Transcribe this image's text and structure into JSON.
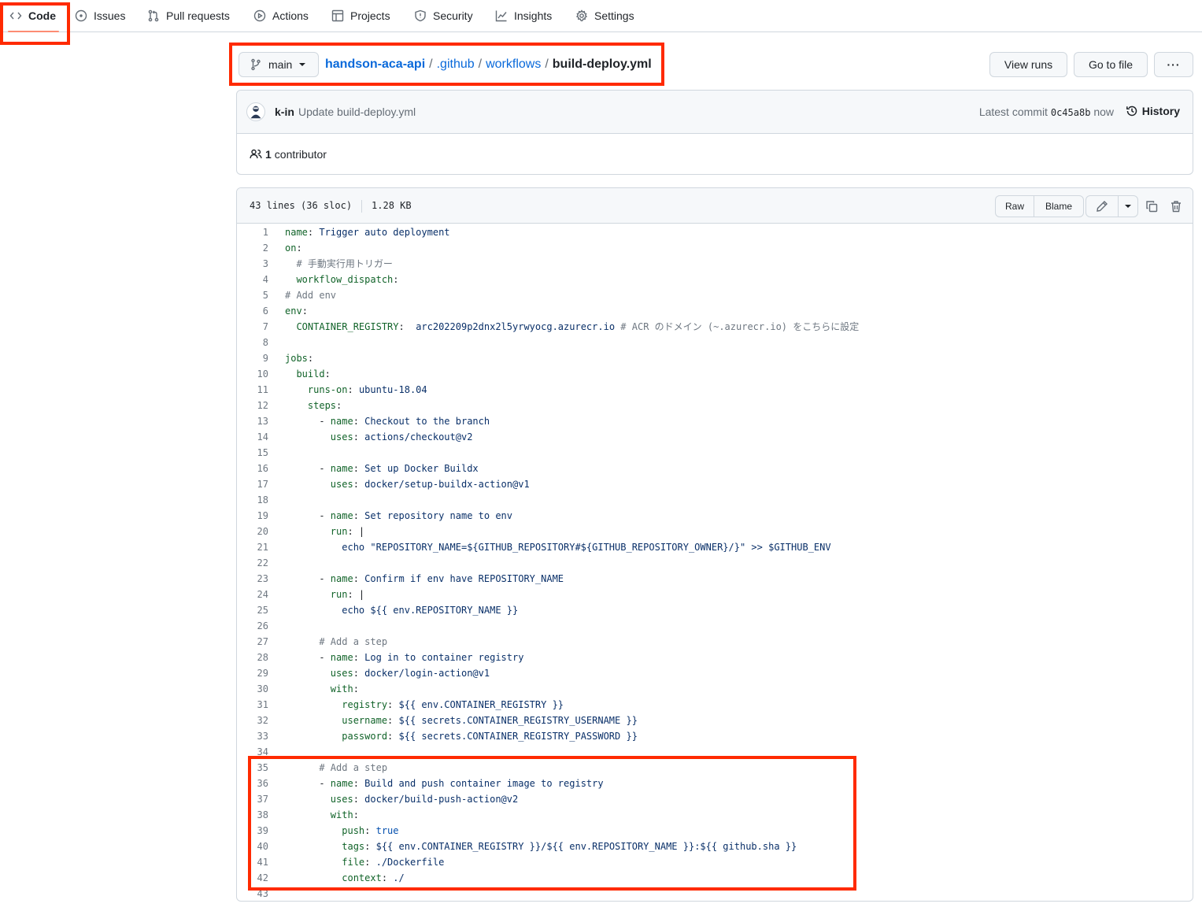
{
  "nav": {
    "tabs": [
      {
        "label": "Code",
        "icon": "code-icon"
      },
      {
        "label": "Issues",
        "icon": "issue-icon"
      },
      {
        "label": "Pull requests",
        "icon": "pull-request-icon"
      },
      {
        "label": "Actions",
        "icon": "play-icon"
      },
      {
        "label": "Projects",
        "icon": "table-icon"
      },
      {
        "label": "Security",
        "icon": "shield-icon"
      },
      {
        "label": "Insights",
        "icon": "graph-icon"
      },
      {
        "label": "Settings",
        "icon": "gear-icon"
      }
    ],
    "active": "Code"
  },
  "branch": {
    "name": "main"
  },
  "breadcrumb": {
    "repo": "handson-aca-api",
    "dir1": ".github",
    "dir2": "workflows",
    "file": "build-deploy.yml",
    "separator": "/"
  },
  "actions": {
    "view_runs": "View runs",
    "go_to_file": "Go to file",
    "more": "···"
  },
  "commit": {
    "author": "k-in",
    "message": "Update build-deploy.yml",
    "latest_label": "Latest commit",
    "sha": "0c45a8b",
    "time": "now",
    "history_label": "History"
  },
  "contributors": {
    "count": "1",
    "label": "contributor"
  },
  "file": {
    "lines_info": "43 lines (36 sloc)",
    "size": "1.28 KB",
    "raw_label": "Raw",
    "blame_label": "Blame"
  },
  "code_lines": [
    [
      [
        "k",
        "name"
      ],
      [
        "p",
        ": "
      ],
      [
        "v",
        "Trigger auto deployment"
      ]
    ],
    [
      [
        "k",
        "on"
      ],
      [
        "p",
        ":"
      ]
    ],
    [
      [
        "p",
        "  "
      ],
      [
        "c",
        "# 手動実行用トリガー"
      ]
    ],
    [
      [
        "p",
        "  "
      ],
      [
        "k",
        "workflow_dispatch"
      ],
      [
        "p",
        ":"
      ]
    ],
    [
      [
        "c",
        "# Add env"
      ]
    ],
    [
      [
        "k",
        "env"
      ],
      [
        "p",
        ":"
      ]
    ],
    [
      [
        "p",
        "  "
      ],
      [
        "k",
        "CONTAINER_REGISTRY"
      ],
      [
        "p",
        ":  "
      ],
      [
        "v",
        "arc202209p2dnx2l5yrwyocg.azurecr.io"
      ],
      [
        "p",
        " "
      ],
      [
        "c",
        "# ACR のドメイン (~.azurecr.io) をこちらに設定"
      ]
    ],
    [],
    [
      [
        "k",
        "jobs"
      ],
      [
        "p",
        ":"
      ]
    ],
    [
      [
        "p",
        "  "
      ],
      [
        "k",
        "build"
      ],
      [
        "p",
        ":"
      ]
    ],
    [
      [
        "p",
        "    "
      ],
      [
        "k",
        "runs-on"
      ],
      [
        "p",
        ": "
      ],
      [
        "v",
        "ubuntu-18.04"
      ]
    ],
    [
      [
        "p",
        "    "
      ],
      [
        "k",
        "steps"
      ],
      [
        "p",
        ":"
      ]
    ],
    [
      [
        "p",
        "      - "
      ],
      [
        "k",
        "name"
      ],
      [
        "p",
        ": "
      ],
      [
        "v",
        "Checkout to the branch"
      ]
    ],
    [
      [
        "p",
        "        "
      ],
      [
        "k",
        "uses"
      ],
      [
        "p",
        ": "
      ],
      [
        "v",
        "actions/checkout@v2"
      ]
    ],
    [],
    [
      [
        "p",
        "      - "
      ],
      [
        "k",
        "name"
      ],
      [
        "p",
        ": "
      ],
      [
        "v",
        "Set up Docker Buildx"
      ]
    ],
    [
      [
        "p",
        "        "
      ],
      [
        "k",
        "uses"
      ],
      [
        "p",
        ": "
      ],
      [
        "v",
        "docker/setup-buildx-action@v1"
      ]
    ],
    [],
    [
      [
        "p",
        "      - "
      ],
      [
        "k",
        "name"
      ],
      [
        "p",
        ": "
      ],
      [
        "v",
        "Set repository name to env"
      ]
    ],
    [
      [
        "p",
        "        "
      ],
      [
        "k",
        "run"
      ],
      [
        "p",
        ": |"
      ]
    ],
    [
      [
        "p",
        "          "
      ],
      [
        "v",
        "echo \"REPOSITORY_NAME=${GITHUB_REPOSITORY#${GITHUB_REPOSITORY_OWNER}/}\" >> $GITHUB_ENV"
      ]
    ],
    [],
    [
      [
        "p",
        "      - "
      ],
      [
        "k",
        "name"
      ],
      [
        "p",
        ": "
      ],
      [
        "v",
        "Confirm if env have REPOSITORY_NAME"
      ]
    ],
    [
      [
        "p",
        "        "
      ],
      [
        "k",
        "run"
      ],
      [
        "p",
        ": |"
      ]
    ],
    [
      [
        "p",
        "          "
      ],
      [
        "v",
        "echo ${{ env.REPOSITORY_NAME }}"
      ]
    ],
    [],
    [
      [
        "p",
        "      "
      ],
      [
        "c",
        "# Add a step"
      ]
    ],
    [
      [
        "p",
        "      - "
      ],
      [
        "k",
        "name"
      ],
      [
        "p",
        ": "
      ],
      [
        "v",
        "Log in to container registry"
      ]
    ],
    [
      [
        "p",
        "        "
      ],
      [
        "k",
        "uses"
      ],
      [
        "p",
        ": "
      ],
      [
        "v",
        "docker/login-action@v1"
      ]
    ],
    [
      [
        "p",
        "        "
      ],
      [
        "k",
        "with"
      ],
      [
        "p",
        ":"
      ]
    ],
    [
      [
        "p",
        "          "
      ],
      [
        "k",
        "registry"
      ],
      [
        "p",
        ": "
      ],
      [
        "v",
        "${{ env.CONTAINER_REGISTRY }}"
      ]
    ],
    [
      [
        "p",
        "          "
      ],
      [
        "k",
        "username"
      ],
      [
        "p",
        ": "
      ],
      [
        "v",
        "${{ secrets.CONTAINER_REGISTRY_USERNAME }}"
      ]
    ],
    [
      [
        "p",
        "          "
      ],
      [
        "k",
        "password"
      ],
      [
        "p",
        ": "
      ],
      [
        "v",
        "${{ secrets.CONTAINER_REGISTRY_PASSWORD }}"
      ]
    ],
    [],
    [
      [
        "p",
        "      "
      ],
      [
        "c",
        "# Add a step"
      ]
    ],
    [
      [
        "p",
        "      - "
      ],
      [
        "k",
        "name"
      ],
      [
        "p",
        ": "
      ],
      [
        "v",
        "Build and push container image to registry"
      ]
    ],
    [
      [
        "p",
        "        "
      ],
      [
        "k",
        "uses"
      ],
      [
        "p",
        ": "
      ],
      [
        "v",
        "docker/build-push-action@v2"
      ]
    ],
    [
      [
        "p",
        "        "
      ],
      [
        "k",
        "with"
      ],
      [
        "p",
        ":"
      ]
    ],
    [
      [
        "p",
        "          "
      ],
      [
        "k",
        "push"
      ],
      [
        "p",
        ": "
      ],
      [
        "b",
        "true"
      ]
    ],
    [
      [
        "p",
        "          "
      ],
      [
        "k",
        "tags"
      ],
      [
        "p",
        ": "
      ],
      [
        "v",
        "${{ env.CONTAINER_REGISTRY }}/${{ env.REPOSITORY_NAME }}:${{ github.sha }}"
      ]
    ],
    [
      [
        "p",
        "          "
      ],
      [
        "k",
        "file"
      ],
      [
        "p",
        ": "
      ],
      [
        "v",
        "./Dockerfile"
      ]
    ],
    [
      [
        "p",
        "          "
      ],
      [
        "k",
        "context"
      ],
      [
        "p",
        ": "
      ],
      [
        "v",
        "./"
      ]
    ],
    []
  ],
  "colors": {
    "highlight": "#ff2a00",
    "link": "#0969da",
    "tab_underline": "#fd8c73"
  }
}
